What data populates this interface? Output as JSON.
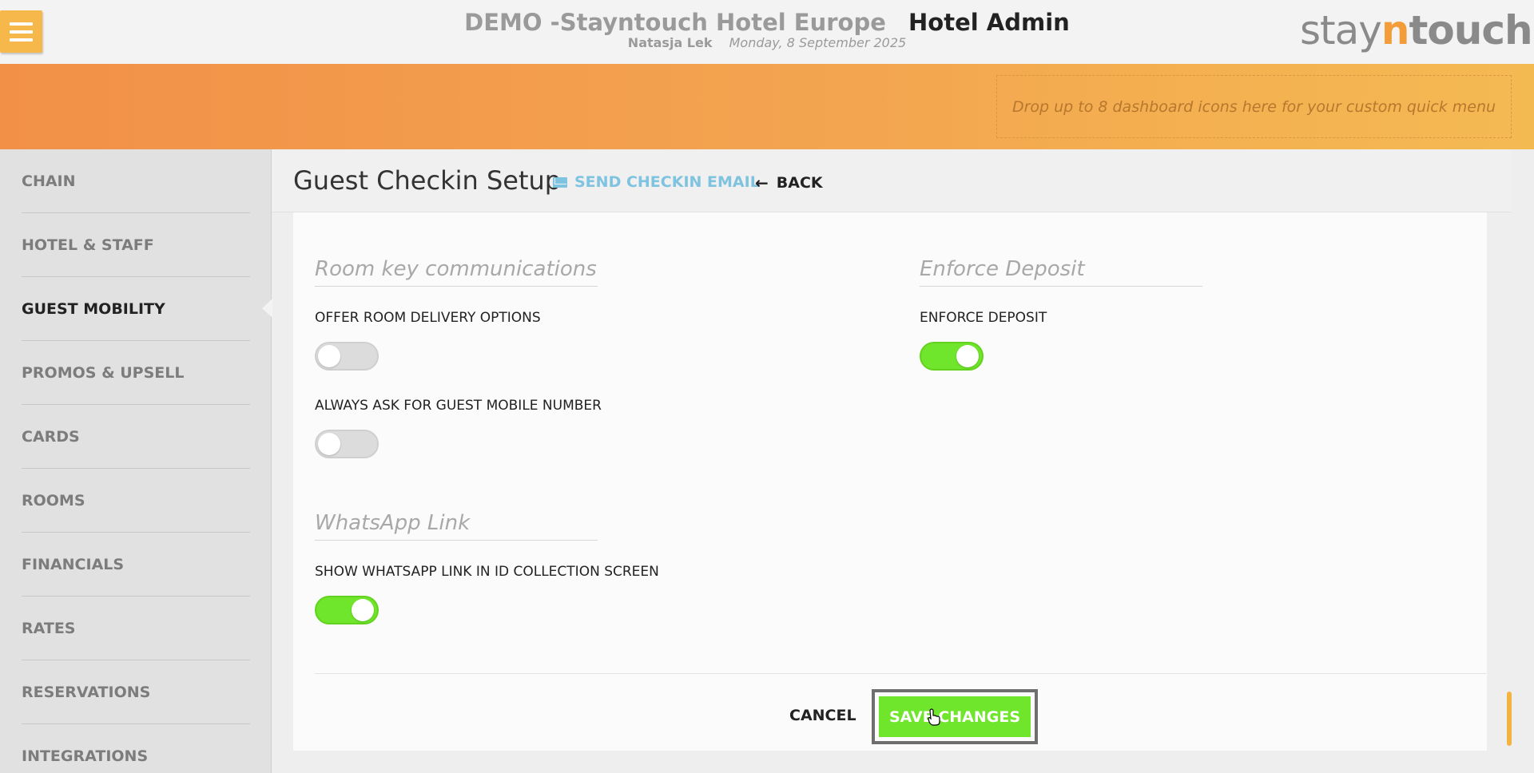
{
  "header": {
    "hotel_name": "DEMO -Stayntouch Hotel Europe",
    "app_title": "Hotel Admin",
    "user_name": "Natasja Lek",
    "date": "Monday, 8 September 2025",
    "logo": {
      "part1": "stay",
      "part2": "n",
      "part3": "touch"
    }
  },
  "quick_menu": {
    "hint": "Drop up to 8 dashboard icons here for your custom quick menu"
  },
  "sidebar": {
    "active": "GUEST MOBILITY",
    "items": [
      {
        "label": "CHAIN"
      },
      {
        "label": "HOTEL & STAFF"
      },
      {
        "label": "GUEST MOBILITY"
      },
      {
        "label": "PROMOS & UPSELL"
      },
      {
        "label": "CARDS"
      },
      {
        "label": "ROOMS"
      },
      {
        "label": "FINANCIALS"
      },
      {
        "label": "RATES"
      },
      {
        "label": "RESERVATIONS"
      },
      {
        "label": "INTEGRATIONS"
      }
    ]
  },
  "page": {
    "title": "Guest Checkin Setup",
    "send_email_label": "SEND CHECKIN EMAIL",
    "back_label": "BACK"
  },
  "sections": {
    "room_key": {
      "title": "Room key communications",
      "offer_delivery": {
        "label": "OFFER ROOM DELIVERY OPTIONS",
        "enabled": false
      },
      "ask_mobile": {
        "label": "ALWAYS ASK FOR GUEST MOBILE NUMBER",
        "enabled": false
      }
    },
    "enforce_deposit": {
      "title": "Enforce Deposit",
      "enforce": {
        "label": "ENFORCE DEPOSIT",
        "enabled": true
      }
    },
    "whatsapp": {
      "title": "WhatsApp Link",
      "show_link": {
        "label": "SHOW WHATSAPP LINK IN ID COLLECTION SCREEN",
        "enabled": true
      }
    }
  },
  "footer": {
    "cancel_label": "CANCEL",
    "save_label": "SAVE CHANGES"
  },
  "colors": {
    "accent_orange": "#f4ba52",
    "toggle_on": "#6fe52b",
    "link_blue": "#7ec3e0"
  }
}
